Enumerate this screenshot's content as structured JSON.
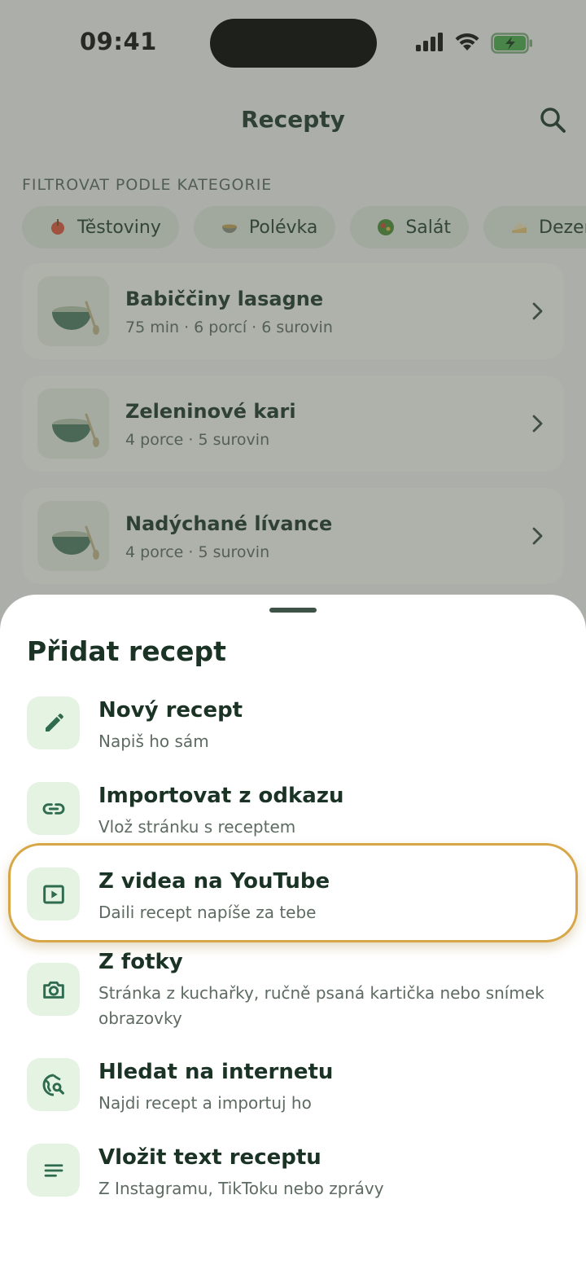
{
  "status_bar": {
    "time": "09:41"
  },
  "header": {
    "title": "Recepty"
  },
  "filter": {
    "label": "FILTROVAT PODLE KATEGORIE",
    "chips": [
      {
        "label": "Těstoviny",
        "icon": "pasta-icon"
      },
      {
        "label": "Polévka",
        "icon": "soup-icon"
      },
      {
        "label": "Salát",
        "icon": "salad-icon"
      },
      {
        "label": "Dezer",
        "icon": "cake-icon"
      }
    ]
  },
  "recipes": [
    {
      "name": "Babiččiny lasagne",
      "meta": "75 min · 6 porcí · 6 surovin"
    },
    {
      "name": "Zeleninové kari",
      "meta": "4 porce · 5 surovin"
    },
    {
      "name": "Nadýchané lívance",
      "meta": "4 porce · 5 surovin"
    }
  ],
  "sheet": {
    "title": "Přidat recept",
    "options": [
      {
        "title": "Nový recept",
        "subtitle": "Napiš ho sám",
        "icon": "pencil-icon"
      },
      {
        "title": "Importovat z odkazu",
        "subtitle": "Vlož stránku s receptem",
        "icon": "link-icon"
      },
      {
        "title": "Z videa na YouTube",
        "subtitle": "Daili recept napíše za tebe",
        "icon": "play-video-icon"
      },
      {
        "title": "Z fotky",
        "subtitle": "Stránka z kuchařky, ručně psaná kartička nebo snímek obrazovky",
        "icon": "camera-icon"
      },
      {
        "title": "Hledat na internetu",
        "subtitle": "Najdi recept a importuj ho",
        "icon": "globe-search-icon"
      },
      {
        "title": "Vložit text receptu",
        "subtitle": "Z Instagramu, TikToku nebo zprávy",
        "icon": "text-lines-icon"
      }
    ]
  },
  "colors": {
    "accent": "#2f6b4f",
    "icon_bg": "#e4f3e2",
    "highlight": "#d7a646"
  }
}
